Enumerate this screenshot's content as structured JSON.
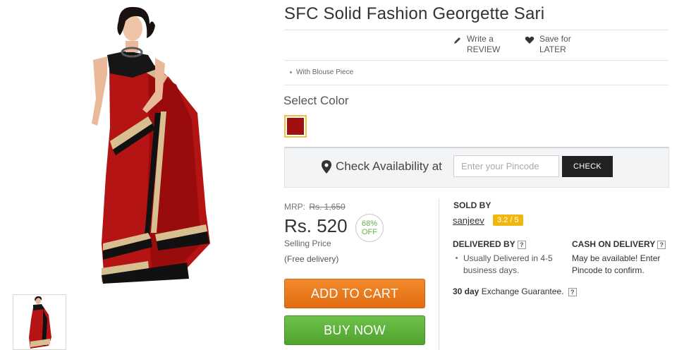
{
  "product": {
    "title": "SFC Solid Fashion Georgette Sari",
    "highlight": "With Blouse Piece"
  },
  "actions": {
    "review_line1": "Write a",
    "review_line2": "REVIEW",
    "save_line1": "Save for",
    "save_line2": "LATER"
  },
  "color": {
    "label": "Select Color",
    "selected_hex": "#a10f0f"
  },
  "availability": {
    "label": "Check Availability at",
    "placeholder": "Enter your Pincode",
    "button": "CHECK"
  },
  "pricing": {
    "mrp_label": "MRP:",
    "mrp_value": "Rs. 1,650",
    "price": "Rs. 520",
    "discount_pct": "68%",
    "discount_word": "OFF",
    "selling_label": "Selling Price",
    "delivery_note": "(Free delivery)"
  },
  "buttons": {
    "add_to_cart": "ADD TO CART",
    "buy_now": "BUY NOW"
  },
  "seller": {
    "label": "SOLD BY",
    "name": "sanjeev",
    "rating": "3.2 / 5"
  },
  "delivery": {
    "heading": "DELIVERED BY",
    "text": "Usually Delivered in 4-5 business days.",
    "cod_heading": "CASH ON DELIVERY",
    "cod_text": "May be available! Enter Pincode to confirm.",
    "help": "?"
  },
  "exchange": {
    "days": "30 day",
    "text": "Exchange Guarantee."
  },
  "colors": {
    "orange": "#e8771c",
    "green": "#5cb038",
    "rating": "#f1b70f",
    "discount": "#6ab04c"
  }
}
